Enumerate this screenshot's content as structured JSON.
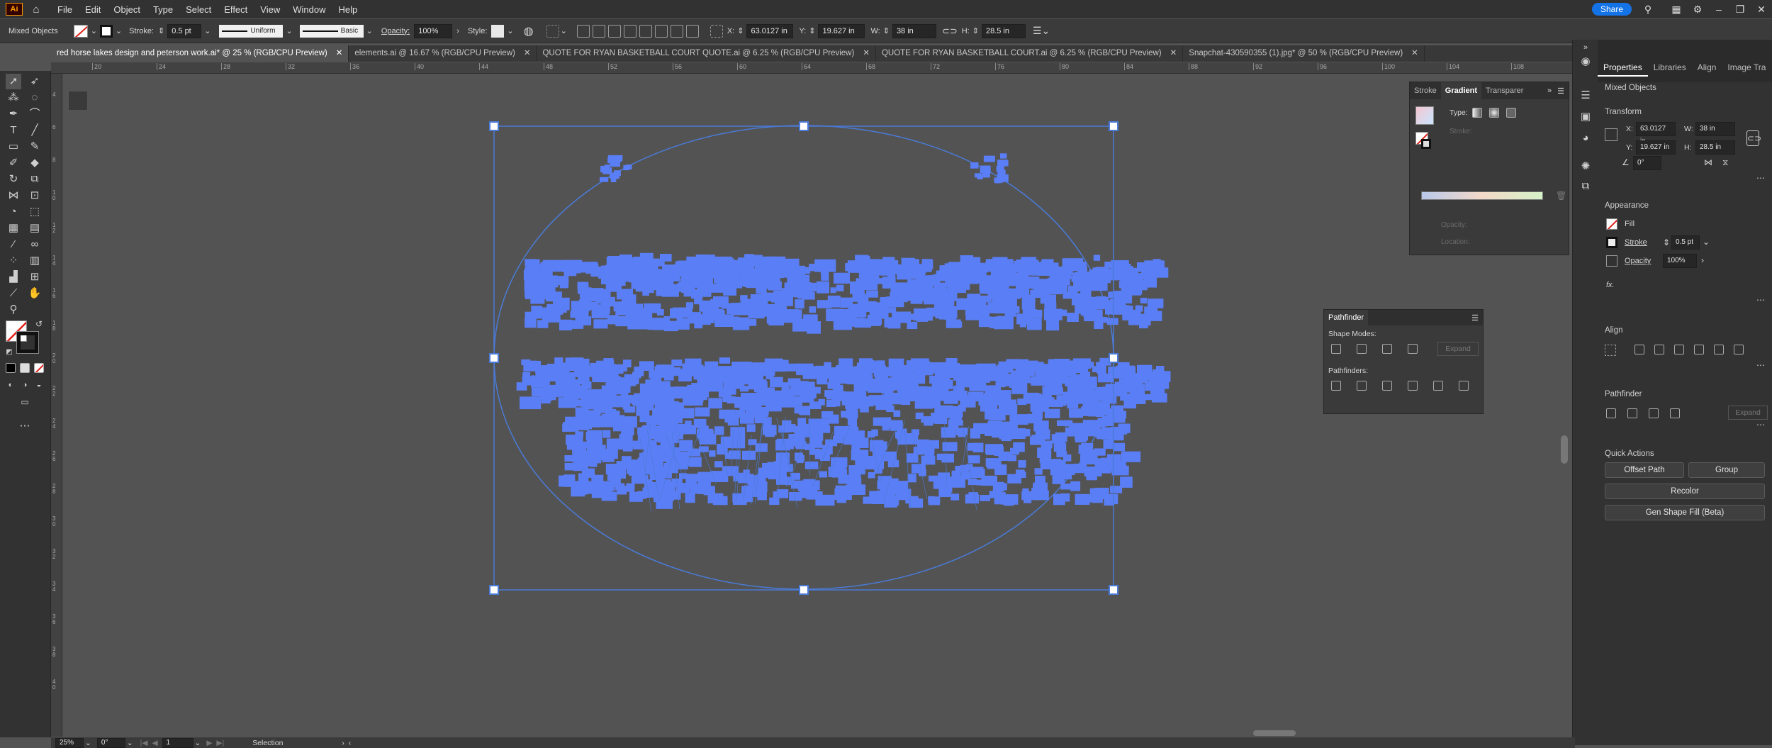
{
  "app": {
    "logo": "Ai",
    "accent": "#1473e6",
    "selection_color": "#4a7bd8",
    "art_color": "#5a7ef5"
  },
  "menus": [
    "File",
    "Edit",
    "Object",
    "Type",
    "Select",
    "Effect",
    "View",
    "Window",
    "Help"
  ],
  "topright": {
    "share": "Share"
  },
  "control": {
    "mixed_objects": "Mixed Objects",
    "stroke_label": "Stroke:",
    "stroke_value": "0.5 pt",
    "uniform": "Uniform",
    "basic": "Basic",
    "opacity_label": "Opacity:",
    "opacity_value": "100%",
    "style_label": "Style:",
    "x_label": "X:",
    "x_value": "63.0127 in",
    "y_label": "Y:",
    "y_value": "19.627 in",
    "w_label": "W:",
    "w_value": "38 in",
    "h_label": "H:",
    "h_value": "28.5 in"
  },
  "tabs": [
    {
      "label": "red horse lakes design and peterson work.ai* @ 25 % (RGB/CPU Preview)",
      "active": true
    },
    {
      "label": "elements.ai @ 16.67 % (RGB/CPU Preview)",
      "active": false
    },
    {
      "label": "QUOTE FOR RYAN BASKETBALL COURT QUOTE.ai @ 6.25 % (RGB/CPU Preview)",
      "active": false
    },
    {
      "label": "QUOTE FOR RYAN BASKETBALL COURT.ai @ 6.25 % (RGB/CPU Preview)",
      "active": false
    },
    {
      "label": "Snapchat-430590355 (1).jpg* @ 50 % (RGB/CPU Preview)",
      "active": false
    }
  ],
  "ruler_ticks": [
    "20",
    "24",
    "28",
    "32",
    "36",
    "40",
    "44",
    "48",
    "52",
    "56",
    "60",
    "64",
    "68",
    "72",
    "76",
    "80",
    "84",
    "88",
    "92",
    "96",
    "100",
    "104",
    "108"
  ],
  "vruler_ticks": [
    "4",
    "6",
    "8",
    "1 0",
    "1 2",
    "1 4",
    "1 6",
    "1 8",
    "2 0",
    "2 2",
    "2 4",
    "2 6",
    "2 8",
    "3 0",
    "3 2",
    "3 4",
    "3 6",
    "3 8",
    "4 0"
  ],
  "gradient_panel": {
    "tabs": [
      "Stroke",
      "Gradient",
      "Transparer"
    ],
    "type_label": "Type:",
    "stroke_label": "Stroke:",
    "opacity_label": "Opacity:",
    "location_label": "Location:"
  },
  "pathfinder_panel": {
    "title": "Pathfinder",
    "shape_modes": "Shape Modes:",
    "expand": "Expand",
    "pathfinders": "Pathfinders:"
  },
  "properties": {
    "tabs": [
      "Properties",
      "Libraries",
      "Align",
      "Image Tra"
    ],
    "selection": "Mixed Objects",
    "transform": "Transform",
    "x_label": "X:",
    "x": "63.0127 in",
    "y_label": "Y:",
    "y": "19.627 in",
    "w_label": "W:",
    "w": "38 in",
    "h_label": "H:",
    "h": "28.5 in",
    "angle": "0°",
    "appearance": "Appearance",
    "fill": "Fill",
    "stroke": "Stroke",
    "stroke_value": "0.5 pt",
    "opacity": "Opacity",
    "opacity_value": "100%",
    "fx": "fx.",
    "align": "Align",
    "pathfinder": "Pathfinder",
    "expand": "Expand",
    "quick_actions": "Quick Actions",
    "offset_path": "Offset Path",
    "group": "Group",
    "recolor": "Recolor",
    "gen_shape_fill": "Gen Shape Fill (Beta)"
  },
  "status": {
    "zoom": "25%",
    "angle": "0°",
    "artboard": "1",
    "tool": "Selection"
  }
}
